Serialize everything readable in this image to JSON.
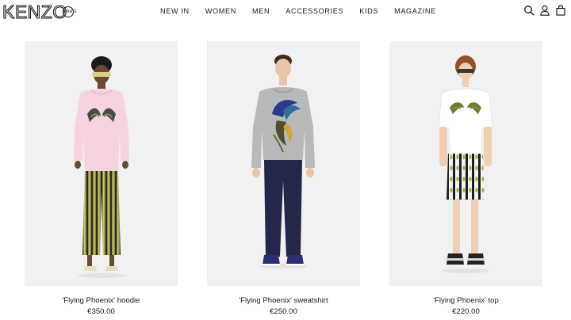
{
  "brand": {
    "logo_text": "KENZO",
    "seal_text": "PARIS"
  },
  "nav": {
    "items": [
      {
        "label": "NEW IN"
      },
      {
        "label": "WOMEN"
      },
      {
        "label": "MEN"
      },
      {
        "label": "ACCESSORIES"
      },
      {
        "label": "KIDS"
      },
      {
        "label": "MAGAZINE"
      }
    ]
  },
  "tools": {
    "search_icon": "search-icon",
    "account_icon": "account-icon",
    "bag_icon": "shopping-bag-icon"
  },
  "products": [
    {
      "name": "'Flying Phoenix' hoodie",
      "price": "€350.00"
    },
    {
      "name": "'Flying Phoenix' sweatshirt",
      "price": "€250.00"
    },
    {
      "name": "'Flying Phoenix' top",
      "price": "€220.00"
    }
  ],
  "colors": {
    "text": "#1a1a1a",
    "photo_background": "#f1f1f1",
    "hoodie": "#f6d3e0",
    "sweatshirt": "#b8b9bb",
    "trousers": "#23284a",
    "top": "#ffffff"
  }
}
